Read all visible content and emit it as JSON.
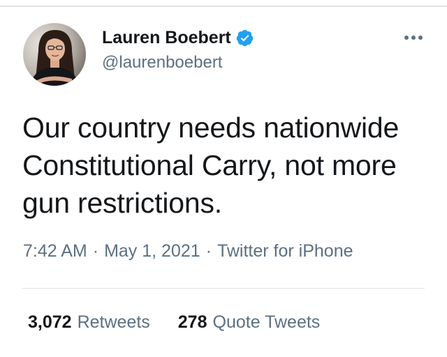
{
  "author": {
    "display_name": "Lauren Boebert",
    "handle": "@laurenboebert",
    "verified": true,
    "verified_color": "#1da1f2"
  },
  "tweet": {
    "text": "Our country needs nationwide Constitutional Carry, not more gun restrictions.",
    "time": "7:42 AM",
    "separator": "·",
    "date": "May 1, 2021",
    "source": "Twitter for iPhone"
  },
  "stats": {
    "retweets_count": "3,072",
    "retweets_label": "Retweets",
    "quotes_count": "278",
    "quotes_label": "Quote Tweets"
  },
  "icons": {
    "more": "more-horizontal-icon",
    "verified": "verified-badge-icon"
  },
  "colors": {
    "text_primary": "#14171a",
    "text_secondary": "#5b7083",
    "divider": "#dfe3e6"
  }
}
